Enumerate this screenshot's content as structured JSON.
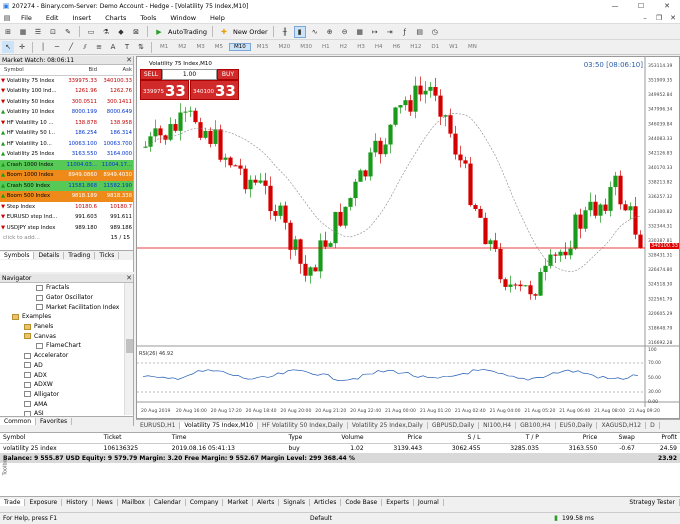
{
  "window": {
    "title": "207274 - Binary.com-Server: Demo Account - Hedge - [Volatility 75 Index,M10]"
  },
  "menu": [
    "File",
    "Edit",
    "Insert",
    "Charts",
    "Tools",
    "Window",
    "Help"
  ],
  "toolbar": {
    "autotrading": "AutoTrading",
    "new_order": "New Order"
  },
  "timeframes": [
    "M1",
    "M2",
    "M3",
    "M5",
    "M10",
    "M15",
    "M20",
    "M30",
    "H1",
    "H2",
    "H3",
    "H4",
    "H6",
    "H12",
    "D1",
    "W1",
    "MN"
  ],
  "timeframe_selected": "M10",
  "market_watch": {
    "title": "Market Watch: 08:06:11",
    "headers": [
      "Symbol",
      "Bid",
      "Ask"
    ],
    "rows": [
      {
        "symbol": "Volatility 75 Index",
        "bid": "339975.33",
        "ask": "340100.33",
        "color": "#ffffff",
        "text": "#c00000"
      },
      {
        "symbol": "Volatility 100 Ind...",
        "bid": "1261.96",
        "ask": "1262.76",
        "color": "#ffffff",
        "text": "#c00000"
      },
      {
        "symbol": "Volatility 50 Index",
        "bid": "300.0511",
        "ask": "300.1411",
        "color": "#ffffff",
        "text": "#c00000"
      },
      {
        "symbol": "Volatility 10 Index",
        "bid": "8000.199",
        "ask": "8000.649",
        "color": "#ffffff",
        "text": "#0033cc"
      },
      {
        "symbol": "HF Volatility 10 ...",
        "bid": "138.878",
        "ask": "138.958",
        "color": "#ffffff",
        "text": "#c00000"
      },
      {
        "symbol": "HF Volatility 50 I...",
        "bid": "186.254",
        "ask": "186.314",
        "color": "#ffffff",
        "text": "#0033cc"
      },
      {
        "symbol": "HF Volatility 10...",
        "bid": "10063.100",
        "ask": "10063.700",
        "color": "#ffffff",
        "text": "#0033cc"
      },
      {
        "symbol": "Volatility 25 Index",
        "bid": "3163.550",
        "ask": "3164.000",
        "color": "#ffffff",
        "text": "#0033cc"
      },
      {
        "symbol": "Crash 1000 Index",
        "bid": "11004.03...",
        "ask": "11004.17...",
        "color": "#57c957",
        "text": "#0033cc"
      },
      {
        "symbol": "Boom 1000 Index",
        "bid": "8949.0860",
        "ask": "8949.4030",
        "color": "#ee8a1a",
        "text": "#ffffff"
      },
      {
        "symbol": "Crash 500 Index",
        "bid": "11581.868",
        "ask": "11582.190",
        "color": "#57c957",
        "text": "#0033cc"
      },
      {
        "symbol": "Boom 500 Index",
        "bid": "9818.189",
        "ask": "9818.338",
        "color": "#ee8a1a",
        "text": "#ffffff"
      },
      {
        "symbol": "Step Index",
        "bid": "10180.6",
        "ask": "10180.7",
        "color": "#ffffff",
        "text": "#c00000"
      },
      {
        "symbol": "EURUSD step Ind...",
        "bid": "991.603",
        "ask": "991.611",
        "color": "#ffffff",
        "text": "#000000"
      },
      {
        "symbol": "USDJPY step Index",
        "bid": "989.180",
        "ask": "989.186",
        "color": "#ffffff",
        "text": "#000000"
      }
    ],
    "add_row": "click to add...",
    "count": "15 / 15",
    "tabs": [
      "Symbols",
      "Details",
      "Trading",
      "Ticks"
    ]
  },
  "navigator": {
    "title": "Navigator",
    "items": [
      {
        "label": "Fractals",
        "kind": "indicator",
        "level": 3
      },
      {
        "label": "Gator Oscillator",
        "kind": "indicator",
        "level": 3
      },
      {
        "label": "Market Facilitation Index",
        "kind": "indicator",
        "level": 3
      },
      {
        "label": "Examples",
        "kind": "folder",
        "level": 1
      },
      {
        "label": "Panels",
        "kind": "folder",
        "level": 2
      },
      {
        "label": "Canvas",
        "kind": "folder",
        "level": 2
      },
      {
        "label": "FlameChart",
        "kind": "indicator",
        "level": 3
      },
      {
        "label": "Accelerator",
        "kind": "indicator",
        "level": 2
      },
      {
        "label": "AD",
        "kind": "indicator",
        "level": 2
      },
      {
        "label": "ADX",
        "kind": "indicator",
        "level": 2
      },
      {
        "label": "ADXW",
        "kind": "indicator",
        "level": 2
      },
      {
        "label": "Alligator",
        "kind": "indicator",
        "level": 2
      },
      {
        "label": "AMA",
        "kind": "indicator",
        "level": 2
      },
      {
        "label": "ASI",
        "kind": "indicator",
        "level": 2
      }
    ],
    "tabs": [
      "Common",
      "Favorites"
    ]
  },
  "chart": {
    "symbol_label": "Volatility 75 Index,M10",
    "sell": {
      "label": "SELL",
      "prefix": "339975",
      "big": "33"
    },
    "buy": {
      "label": "BUY",
      "prefix": "340100",
      "big": "33"
    },
    "lot": "1.00",
    "timer": "03:50 [08:06:10]",
    "rsi_label": "RSI(26) 46.92",
    "current_price": "340100.33",
    "price_ticks": [
      "353114.39",
      "351909.35",
      "349952.84",
      "347996.34",
      "346039.84",
      "344083.33",
      "342126.83",
      "340170.33",
      "338213.82",
      "336257.32",
      "334300.82",
      "332344.31",
      "330387.81",
      "328431.31",
      "326474.80",
      "324518.30",
      "322561.79",
      "320605.29",
      "318648.79",
      "316692.28"
    ],
    "rsi_ticks": [
      "100",
      "70.00",
      "50.00",
      "30.00",
      "0.00"
    ],
    "time_ticks": [
      "20 Aug 2019",
      "20 Aug 16:00",
      "20 Aug 17:20",
      "20 Aug 18:40",
      "20 Aug 20:00",
      "20 Aug 21:20",
      "20 Aug 22:40",
      "21 Aug 00:00",
      "21 Aug 01:20",
      "21 Aug 02:40",
      "21 Aug 04:00",
      "21 Aug 05:20",
      "21 Aug 06:40",
      "21 Aug 08:00",
      "21 Aug 09:20"
    ]
  },
  "chart_tabs": [
    "EURUSD,H1",
    "Volatility 75 Index,M10",
    "HF Volatility 50 Index,Daily",
    "Volatility 25 Index,Daily",
    "GBPUSD,Daily",
    "NI100,H4",
    "GB100,H4",
    "EU50,Daily",
    "XAGUSD,H12",
    "D"
  ],
  "chart_tab_active": 1,
  "trade": {
    "headers": [
      "Symbol",
      "Ticket",
      "Time",
      "Type",
      "Volume",
      "Price",
      "S / L",
      "T / P",
      "Price",
      "Swap",
      "Profit"
    ],
    "row": [
      "volatility 25 index",
      "106136325",
      "2019.08.16 05:41:13",
      "buy",
      "1.02",
      "3139.443",
      "3062.455",
      "3285.035",
      "3163.550",
      "-0.67",
      "24.59"
    ],
    "balance": "Balance: 9 555.87 USD  Equity: 9 579.79  Margin: 3.20  Free Margin: 9 552.67  Margin Level: 299 368.44 %",
    "total": "23.92"
  },
  "bottom_tabs": [
    "Trade",
    "Exposure",
    "History",
    "News",
    "Mailbox",
    "Calendar",
    "Company",
    "Market",
    "Alerts",
    "Signals",
    "Articles",
    "Code Base",
    "Experts",
    "Journal"
  ],
  "strategy_tester": "Strategy Tester",
  "toolbox_label": "Toolbox",
  "status": {
    "help": "For Help, press F1",
    "profile": "Default",
    "traffic": "199.58 ms"
  }
}
